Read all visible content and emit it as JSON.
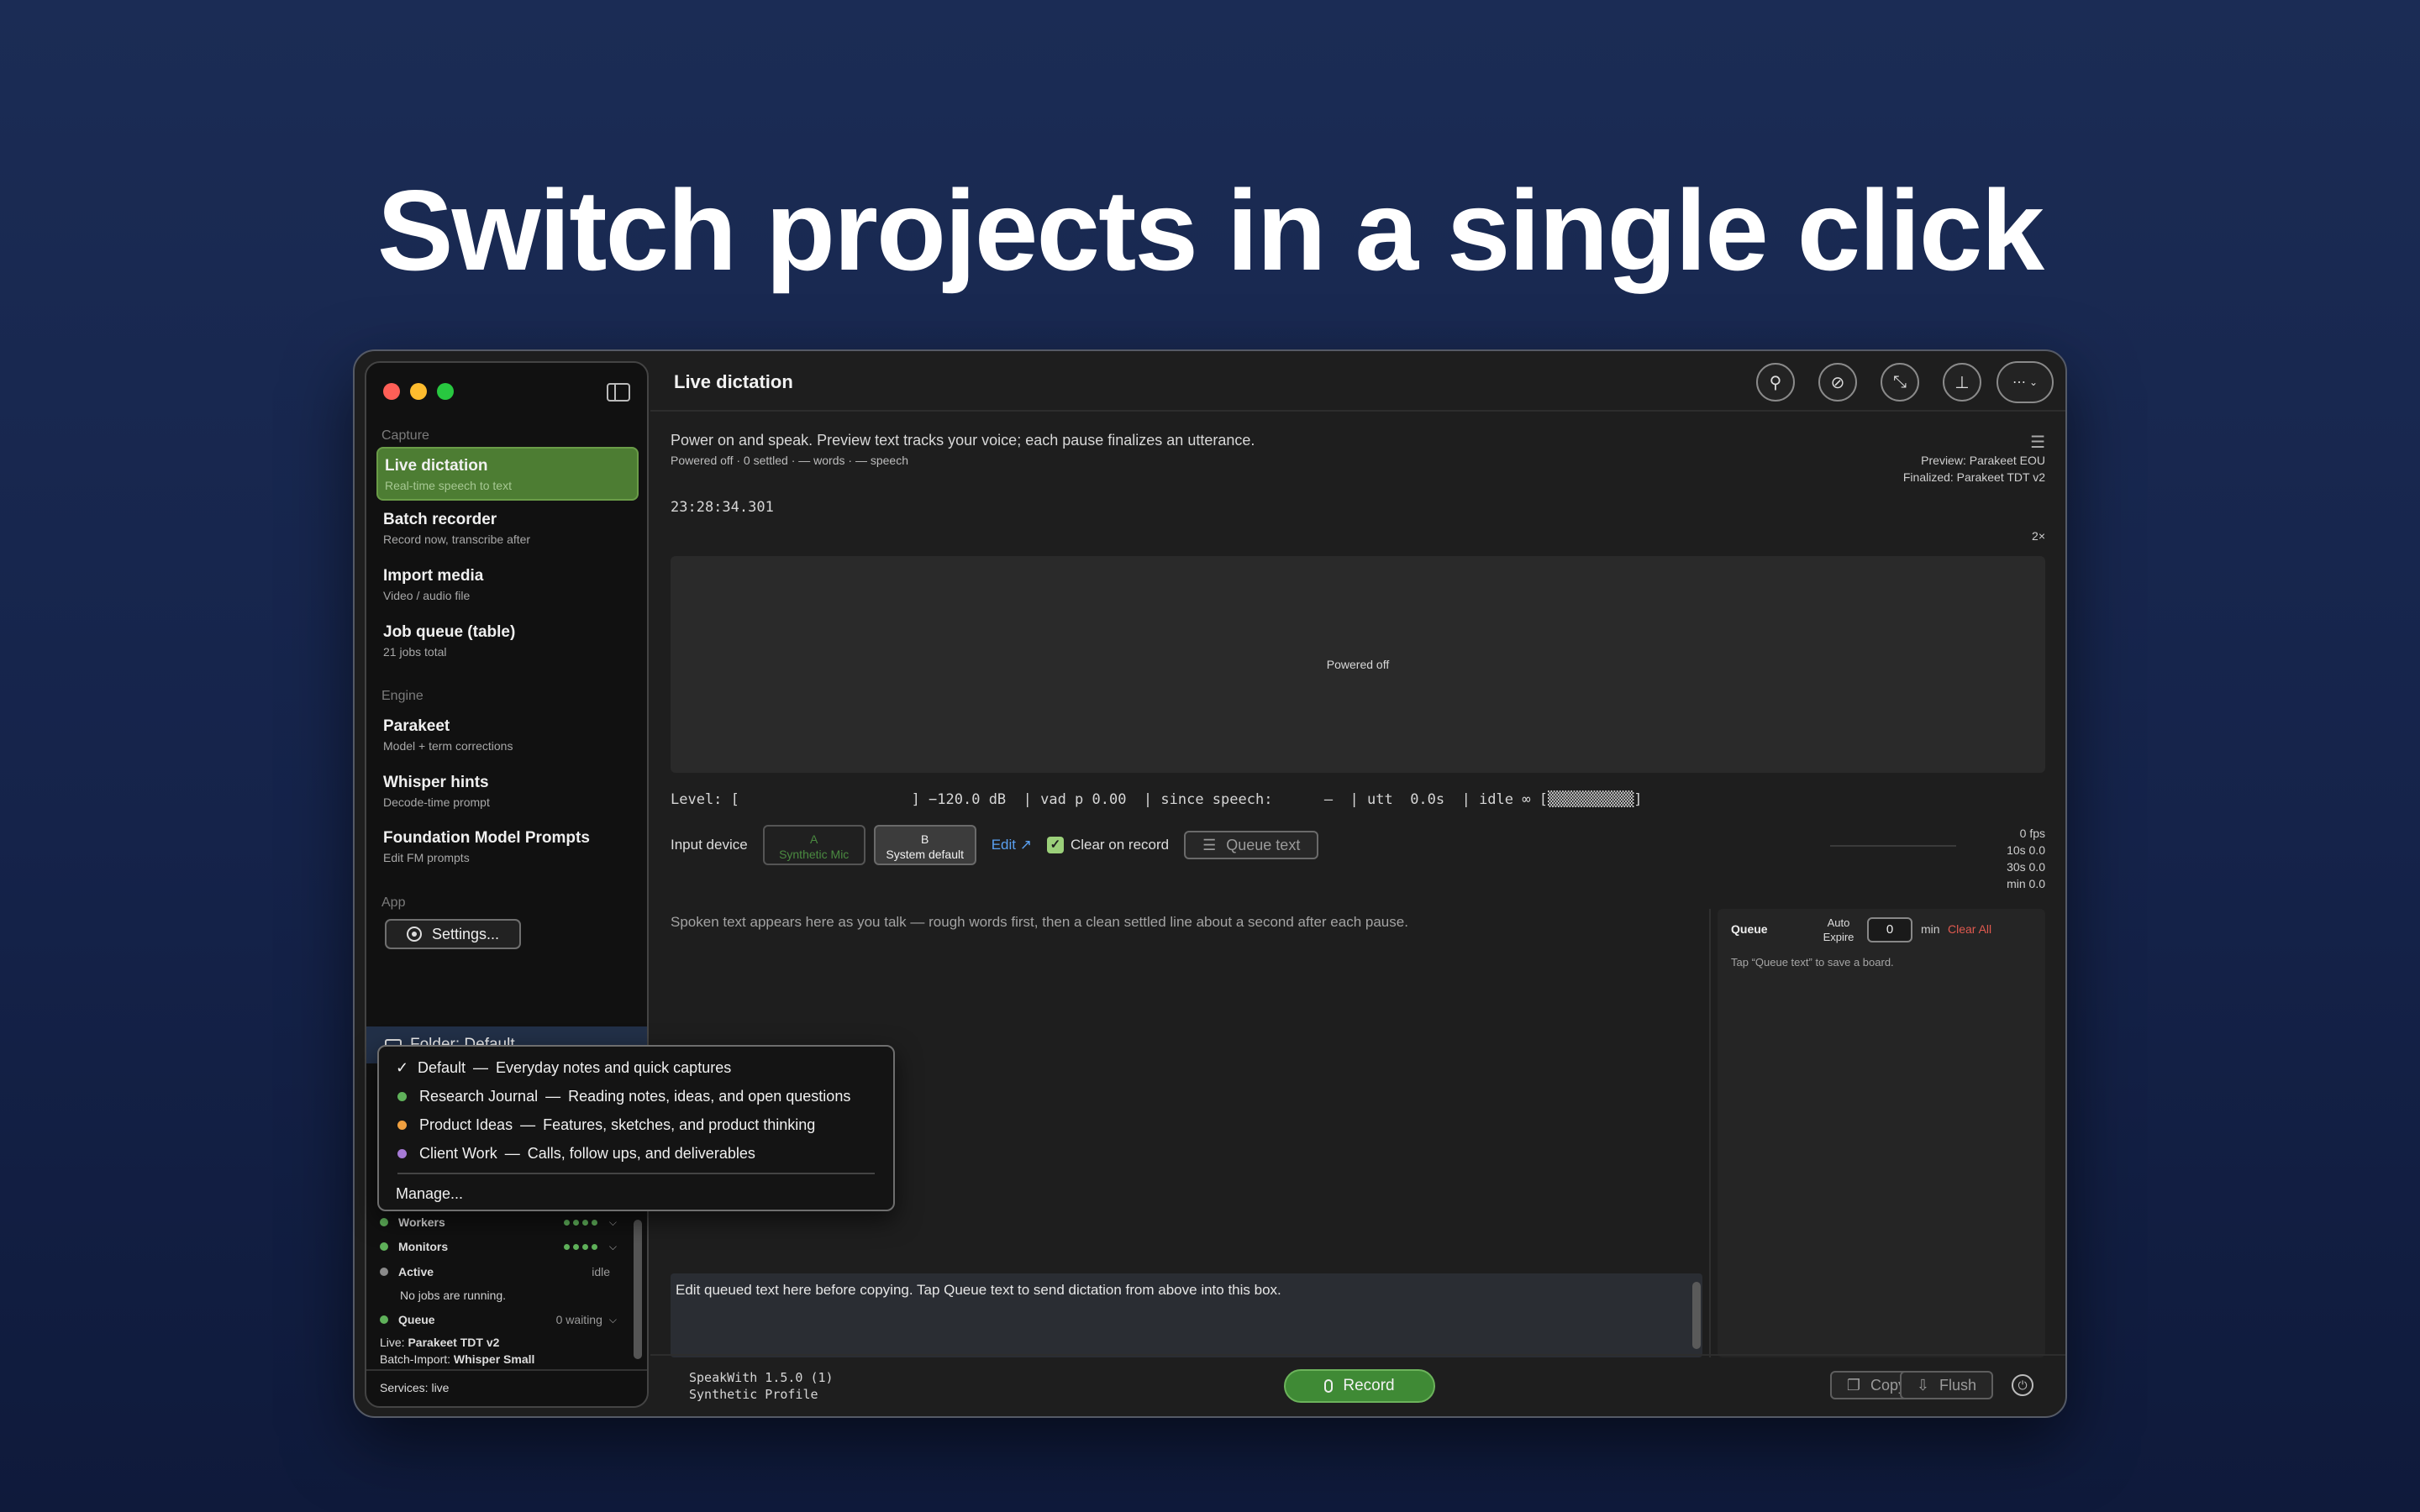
{
  "headline": "Switch projects in a single click",
  "sidebar": {
    "capture_label": "Capture",
    "engine_label": "Engine",
    "app_label": "App",
    "items": [
      {
        "title": "Live dictation",
        "subtitle": "Real-time speech to text"
      },
      {
        "title": "Batch recorder",
        "subtitle": "Record now, transcribe after"
      },
      {
        "title": "Import media",
        "subtitle": "Video / audio file"
      },
      {
        "title": "Job queue (table)",
        "subtitle": "21 jobs total"
      },
      {
        "title": "Parakeet",
        "subtitle": "Model + term corrections"
      },
      {
        "title": "Whisper hints",
        "subtitle": "Decode-time prompt"
      },
      {
        "title": "Foundation Model Prompts",
        "subtitle": "Edit FM prompts"
      }
    ],
    "settings_label": "Settings...",
    "folder_label": "Folder: Default",
    "status": [
      {
        "label": "Workers",
        "right": "",
        "color": "#5fb15a"
      },
      {
        "label": "Monitors",
        "right": "",
        "color": "#5fb15a"
      },
      {
        "label": "Active",
        "right": "idle",
        "color": "#8a8a8a"
      },
      {
        "label": "Queue",
        "right": "0 waiting",
        "color": "#5fb15a"
      }
    ],
    "no_jobs": "No jobs are running.",
    "live_label": "Live:",
    "live_value": "Parakeet TDT v2",
    "batch_label": "Batch-Import:",
    "batch_value": "Whisper Small",
    "services": "Services: live"
  },
  "folder_menu": {
    "items": [
      {
        "name": "Default",
        "desc": "Everyday notes and quick captures",
        "checked": true,
        "color": ""
      },
      {
        "name": "Research Journal",
        "desc": "Reading notes, ideas, and open questions",
        "checked": false,
        "color": "#5fb15a"
      },
      {
        "name": "Product Ideas",
        "desc": "Features, sketches, and product thinking",
        "checked": false,
        "color": "#f0a040"
      },
      {
        "name": "Client Work",
        "desc": "Calls, follow ups, and deliverables",
        "checked": false,
        "color": "#a67ad6"
      }
    ],
    "separator": "—",
    "manage_label": "Manage..."
  },
  "main": {
    "title": "Live dictation",
    "description": "Power on and speak. Preview text tracks your voice; each pause finalizes an utterance.",
    "meta": "Powered off · 0 settled · — words · — speech",
    "preview_model": "Preview: Parakeet EOU",
    "finalized_model": "Finalized: Parakeet TDT v2",
    "clock": "23:28:34.301",
    "speed": "2×",
    "waveform_status": "Powered off",
    "level_line": "Level: [                    ] −120.0 dB  | vad p 0.00  | since speech:      —  | utt  0.0s  | idle ∞ [▒▒▒▒▒▒▒▒▒▒]",
    "input_device_label": "Input device",
    "device_a": {
      "letter": "A",
      "name": "Synthetic Mic"
    },
    "device_b": {
      "letter": "B",
      "name": "System default"
    },
    "edit_label": "Edit ↗",
    "clear_on_record": "Clear on record",
    "queue_text_label": "Queue text",
    "fps": [
      "0 fps",
      "10s 0.0",
      "30s 0.0",
      "min 0.0"
    ],
    "transcript_placeholder": "Spoken text appears here as you talk — rough words first, then a clean settled line about a second after each pause.",
    "queue_panel": {
      "title": "Queue",
      "auto_expire": "Auto Expire",
      "auto_expire_value": "0",
      "min_label": "min",
      "clear_all": "Clear All",
      "hint": "Tap “Queue text” to save a board."
    },
    "edit_box_text": "Edit queued text here before copying. Tap Queue text to send dictation from above into this box.",
    "version": "SpeakWith 1.5.0 (1)",
    "profile": "Synthetic Profile",
    "record_label": "Record",
    "copy_label": "Copy",
    "flush_label": "Flush"
  },
  "colors": {
    "accent_green": "#4d7d33",
    "link_blue": "#5aa0f0",
    "danger": "#e05a4f"
  }
}
